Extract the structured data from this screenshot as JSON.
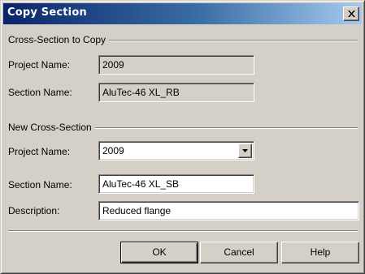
{
  "window": {
    "title": "Copy Section",
    "close_glyph": "close-icon"
  },
  "source_group": {
    "label": "Cross-Section to Copy",
    "project_name_label": "Project Name:",
    "project_name_value": "2009",
    "section_name_label": "Section Name:",
    "section_name_value": "AluTec-46 XL_RB"
  },
  "target_group": {
    "label": "New Cross-Section",
    "project_name_label": "Project Name:",
    "project_name_value": "2009",
    "section_name_label": "Section Name:",
    "section_name_value": "AluTec-46 XL_SB",
    "description_label": "Description:",
    "description_value": "Reduced flange"
  },
  "buttons": {
    "ok": "OK",
    "cancel": "Cancel",
    "help": "Help"
  },
  "colors": {
    "face": "#d4d0c8",
    "title_start": "#0a246a",
    "title_end": "#a6caf0"
  }
}
